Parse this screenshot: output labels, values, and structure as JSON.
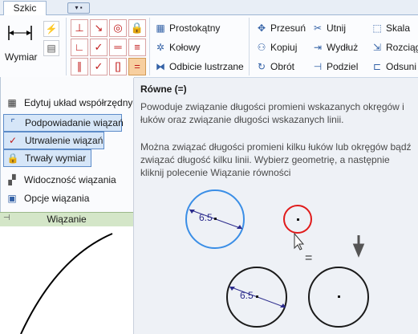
{
  "tabs": {
    "active": "Szkic"
  },
  "ribbon": {
    "wymiar_label": "Wymiar",
    "draw_items": [
      "Prostokątny",
      "Kołowy",
      "Odbicie lustrzane"
    ],
    "modify_items": [
      "Przesuń",
      "Kopiuj",
      "Obrót"
    ],
    "modify_items2": [
      "Utnij",
      "Wydłuż",
      "Podziel"
    ],
    "modify_items3": [
      "Skala",
      "Rozciąg",
      "Odsuni"
    ]
  },
  "menu": {
    "items": [
      "Edytuj układ współrzędnych",
      "Podpowiadanie wiązań",
      "Utrwalenie wiązań",
      "Trwały wymiar",
      "Widoczność wiązania",
      "Opcje wiązania"
    ],
    "footer": "Wiązanie"
  },
  "tooltip": {
    "title": "Równe (=)",
    "description1": "Powoduje związanie długości promieni wskazanych okręgów i łuków oraz związanie długości wskazanych linii.",
    "description2": "Można związać długości promieni kilku łuków lub okręgów bądź związać długość kilku linii. Wybierz geometrię, a następnie kliknij polecenie Wiązanie równości",
    "dimension_before": "6.5",
    "dimension_after": "6.5",
    "equals_sign": "="
  },
  "colors": {
    "selected_circle": "#3a8ee6",
    "highlight_circle": "#e01b1b",
    "dimension": "#2b2b8c",
    "menu_selected": "#d6e6f8",
    "footer_green": "#d4e6c8"
  }
}
